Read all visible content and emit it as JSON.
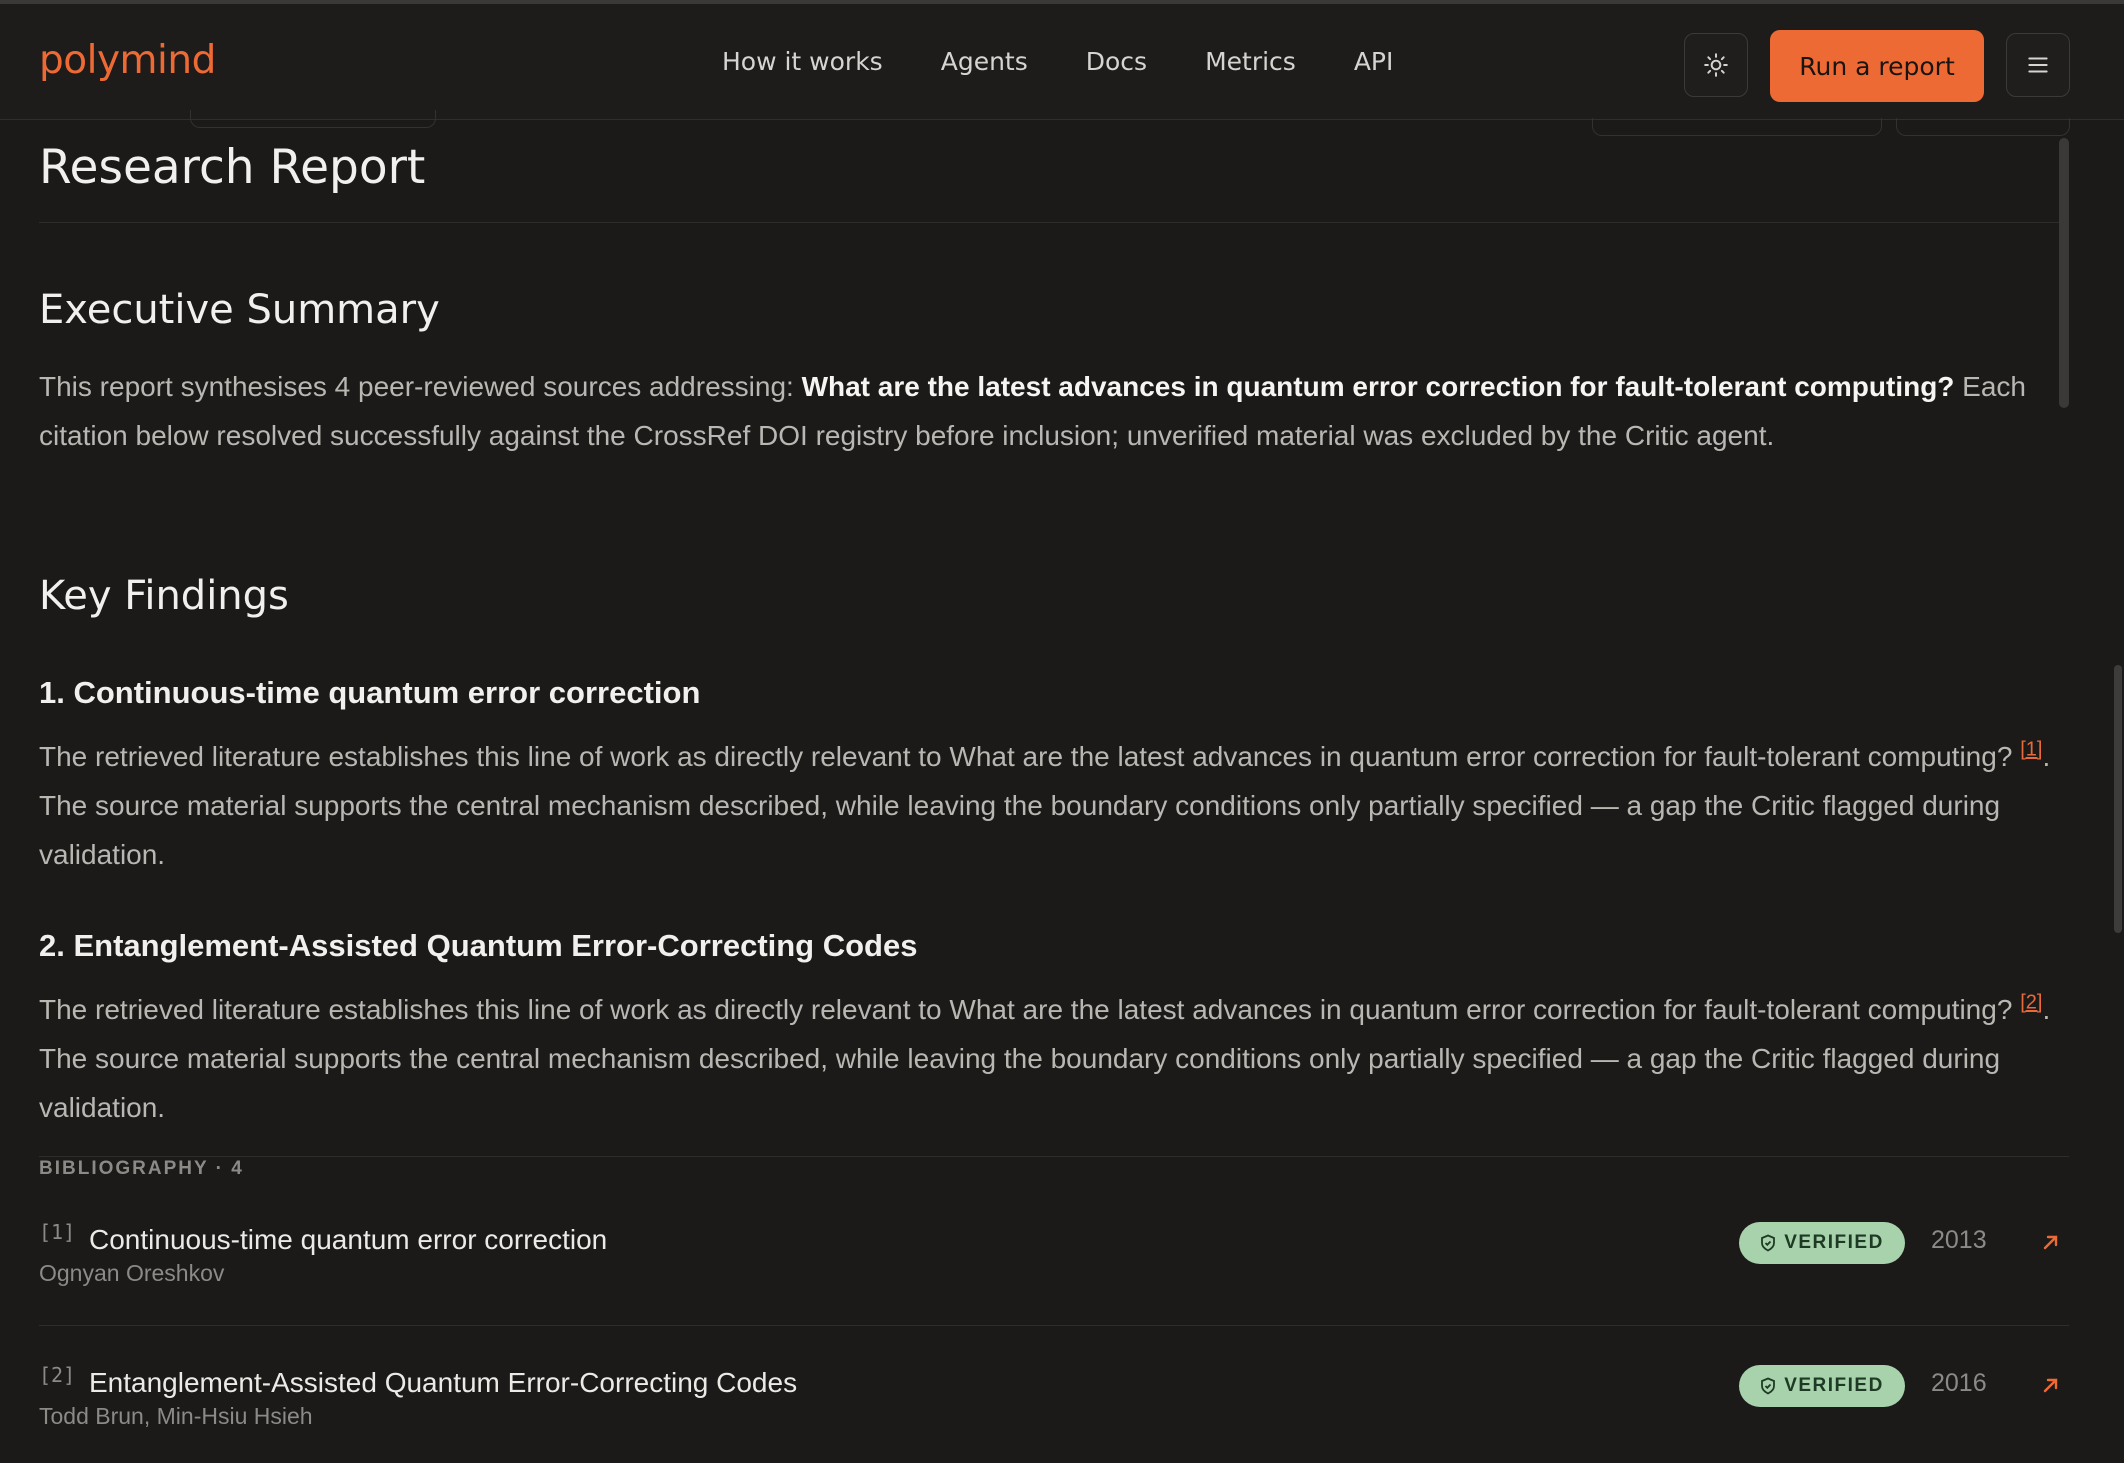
{
  "brand": "polymind",
  "nav": {
    "links": [
      "How it works",
      "Agents",
      "Docs",
      "Metrics",
      "API"
    ],
    "run_label": "Run a report",
    "theme_icon": "sun-icon",
    "menu_icon": "hamburger-menu-icon"
  },
  "report": {
    "title": "Research Report",
    "summary_heading": "Executive Summary",
    "summary_intro": "This report synthesises 4 peer-reviewed sources addressing: ",
    "summary_question": "What are the latest advances in quantum error correction for fault-tolerant computing?",
    "summary_rest": " Each citation below resolved successfully against the CrossRef DOI registry before inclusion; unverified material was excluded by the Critic agent.",
    "findings_heading": "Key Findings",
    "findings": [
      {
        "heading": "1. Continuous-time quantum error correction",
        "text_before": "The retrieved literature establishes this line of work as directly relevant to What are the latest advances in quantum error correction for fault-tolerant computing? ",
        "cite": "[1]",
        "text_after": ". The source material supports the central mechanism described, while leaving the boundary conditions only partially specified — a gap the Critic flagged during validation."
      },
      {
        "heading": "2. Entanglement-Assisted Quantum Error-Correcting Codes",
        "text_before": "The retrieved literature establishes this line of work as directly relevant to What are the latest advances in quantum error correction for fault-tolerant computing? ",
        "cite": "[2]",
        "text_after": ". The source material supports the central mechanism described, while leaving the boundary conditions only partially specified — a gap the Critic flagged during validation."
      }
    ]
  },
  "bibliography": {
    "label": "BIBLIOGRAPHY · 4",
    "entries": [
      {
        "num": "[1]",
        "title": "Continuous-time quantum error correction",
        "authors": "Ognyan Oreshkov",
        "badge": "VERIFIED",
        "year": "2013"
      },
      {
        "num": "[2]",
        "title": "Entanglement-Assisted Quantum Error-Correcting Codes",
        "authors": "Todd Brun, Min-Hsiu Hsieh",
        "badge": "VERIFIED",
        "year": "2016"
      }
    ]
  },
  "colors": {
    "accent": "#ee6a35",
    "verified_bg": "#a7d2ac",
    "background": "#1b1a19"
  }
}
